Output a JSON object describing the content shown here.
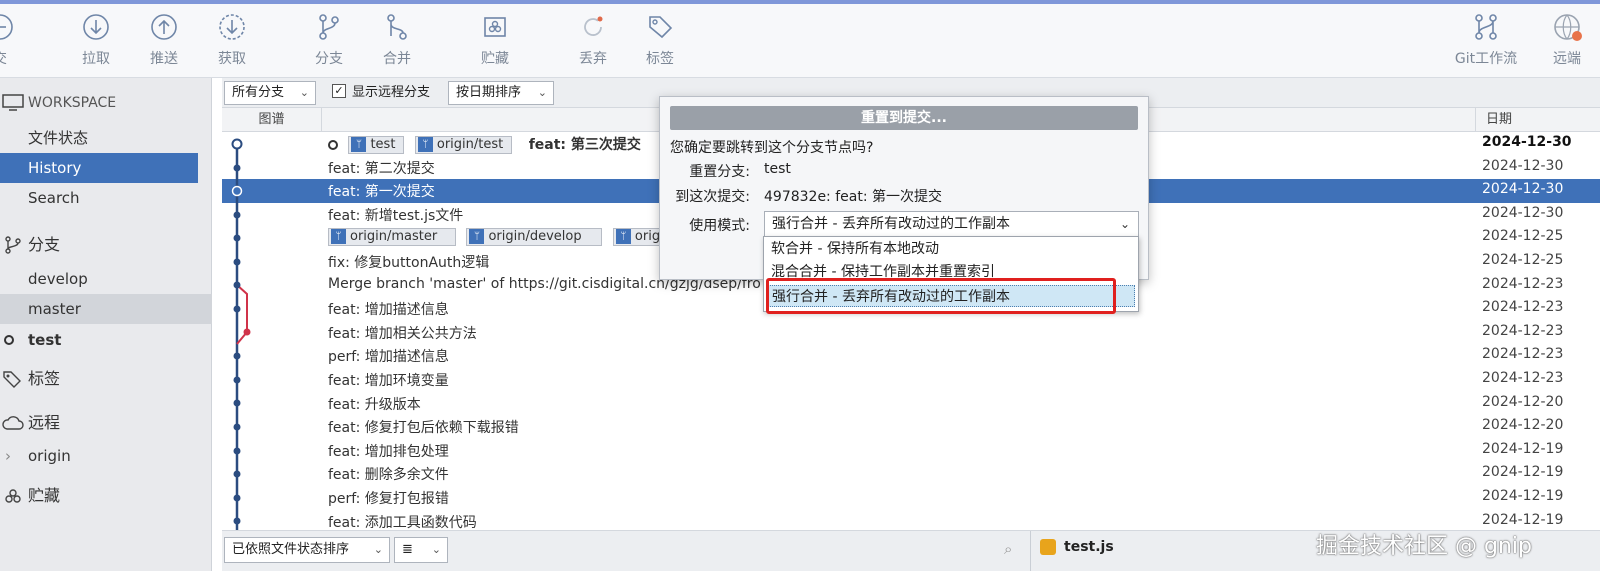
{
  "toolbar": {
    "buttons": [
      {
        "name": "commit",
        "label": "交",
        "icon": "commit-icon"
      },
      {
        "name": "pull",
        "label": "拉取",
        "icon": "pull-icon"
      },
      {
        "name": "push",
        "label": "推送",
        "icon": "push-icon"
      },
      {
        "name": "fetch",
        "label": "获取",
        "icon": "fetch-icon"
      },
      {
        "name": "branch",
        "label": "分支",
        "icon": "branch-icon"
      },
      {
        "name": "merge",
        "label": "合并",
        "icon": "merge-icon"
      },
      {
        "name": "stash",
        "label": "贮藏",
        "icon": "stash-icon"
      },
      {
        "name": "discard",
        "label": "丢弃",
        "icon": "discard-icon"
      },
      {
        "name": "tag",
        "label": "标签",
        "icon": "tag-icon"
      },
      {
        "name": "gitflow",
        "label": "Git工作流",
        "icon": "gitflow-icon"
      },
      {
        "name": "remote",
        "label": "远端",
        "icon": "remote-icon"
      }
    ]
  },
  "sidebar": {
    "workspace": "WORKSPACE",
    "file_status": "文件状态",
    "history": "History",
    "search": "Search",
    "branches_title": "分支",
    "branches": [
      "develop",
      "master",
      "test"
    ],
    "tags_title": "标签",
    "remotes_title": "远程",
    "remotes": [
      "origin"
    ],
    "stash_title": "贮藏"
  },
  "filters": {
    "branch_filter": "所有分支",
    "show_remote_checked": true,
    "show_remote_label": "显示远程分支",
    "sort": "按日期排序"
  },
  "columns": {
    "graph": "图谱",
    "date": "日期"
  },
  "commits": [
    {
      "refs": [
        "test",
        "origin/test"
      ],
      "head": true,
      "message": "feat: 第三次提交",
      "date": "2024-12-30",
      "bold": true
    },
    {
      "message": "feat: 第二次提交",
      "date": "2024-12-30"
    },
    {
      "message": "feat: 第一次提交",
      "date": "2024-12-30",
      "selected": true
    },
    {
      "message": "feat: 新增test.js文件",
      "date": "2024-12-30"
    },
    {
      "refs": [
        "origin/master",
        "origin/develop",
        "orig"
      ],
      "message": "",
      "date": "2024-12-25"
    },
    {
      "message": "fix: 修复buttonAuth逻辑",
      "date": "2024-12-25"
    },
    {
      "message": "Merge branch 'master' of https://git.cisdigital.cn/gzjg/dsep/fro",
      "date": "2024-12-23"
    },
    {
      "message": "feat: 增加描述信息",
      "date": "2024-12-23"
    },
    {
      "message": "feat: 增加相关公共方法",
      "date": "2024-12-23"
    },
    {
      "message": "perf: 增加描述信息",
      "date": "2024-12-23"
    },
    {
      "message": "feat: 增加环境变量",
      "date": "2024-12-23"
    },
    {
      "message": "feat: 升级版本",
      "date": "2024-12-20"
    },
    {
      "message": "feat: 修复打包后依赖下载报错",
      "date": "2024-12-20"
    },
    {
      "message": "feat: 增加排包处理",
      "date": "2024-12-19"
    },
    {
      "message": "feat: 删除多余文件",
      "date": "2024-12-19"
    },
    {
      "message": "perf: 修复打包报错",
      "date": "2024-12-19"
    },
    {
      "message": "feat: 添加工具函数代码",
      "date": "2024-12-19"
    }
  ],
  "bottom": {
    "sort": "已依照文件状态排序",
    "list_icon": "≣",
    "file": "test.js"
  },
  "dialog": {
    "title": "重置到提交...",
    "question": "您确定要跳转到这个分支节点吗?",
    "branch_label": "重置分支:",
    "branch_value": "test",
    "commit_label": "到这次提交:",
    "commit_value": "497832e: feat: 第一次提交",
    "mode_label": "使用模式:",
    "mode_value": "强行合并 - 丢弃所有改动过的工作副本",
    "options": [
      "软合并 - 保持所有本地改动",
      "混合合并 - 保持工作副本并重置索引",
      "强行合并 - 丢弃所有改动过的工作副本"
    ]
  },
  "watermark": "掘金技术社区 @ gnip",
  "colors": {
    "accent": "#3f71b8",
    "highlight_box": "#e0201e",
    "graph_red": "#d0334a"
  }
}
